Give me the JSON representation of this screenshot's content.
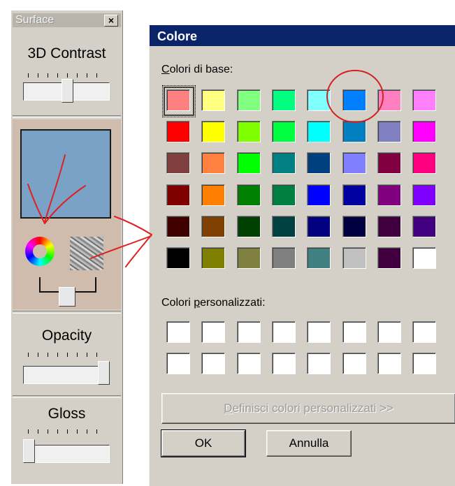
{
  "surface_panel": {
    "title": "Surface",
    "close_label": "×",
    "contrast_label": "3D Contrast",
    "contrast_value": 0.5,
    "color_value": "#7aa2c6",
    "opacity_label": "Opacity",
    "opacity_value": 1.0,
    "gloss_label": "Gloss",
    "gloss_value": 0.0
  },
  "dialog": {
    "title": "Colore",
    "base_colors_label": "Colori di base:",
    "base_colors": [
      [
        "#ff8080",
        "#ffff80",
        "#80ff80",
        "#00ff80",
        "#80ffff",
        "#0080ff",
        "#ff80c0",
        "#ff80ff"
      ],
      [
        "#ff0000",
        "#ffff00",
        "#80ff00",
        "#00ff40",
        "#00ffff",
        "#0080c0",
        "#8080c0",
        "#ff00ff"
      ],
      [
        "#804040",
        "#ff8040",
        "#00ff00",
        "#008080",
        "#004080",
        "#8080ff",
        "#800040",
        "#ff0080"
      ],
      [
        "#800000",
        "#ff8000",
        "#008000",
        "#008040",
        "#0000ff",
        "#0000a0",
        "#800080",
        "#8000ff"
      ],
      [
        "#400000",
        "#804000",
        "#004000",
        "#004040",
        "#000080",
        "#000040",
        "#400040",
        "#400080"
      ],
      [
        "#000000",
        "#808000",
        "#808040",
        "#808080",
        "#408080",
        "#c0c0c0",
        "#400040",
        "#ffffff"
      ]
    ],
    "custom_colors_label": "Colori personalizzati:",
    "custom_colors": [
      [
        "#ffffff",
        "#ffffff",
        "#ffffff",
        "#ffffff",
        "#ffffff",
        "#ffffff",
        "#ffffff",
        "#ffffff"
      ],
      [
        "#ffffff",
        "#ffffff",
        "#ffffff",
        "#ffffff",
        "#ffffff",
        "#ffffff",
        "#ffffff",
        "#ffffff"
      ]
    ],
    "define_button_first": "D",
    "define_button_rest": "efinisci colori personalizzati >>",
    "ok_label": "OK",
    "cancel_label": "Annulla"
  },
  "annotation_color": "#e02020",
  "highlight_color": "#d42020"
}
